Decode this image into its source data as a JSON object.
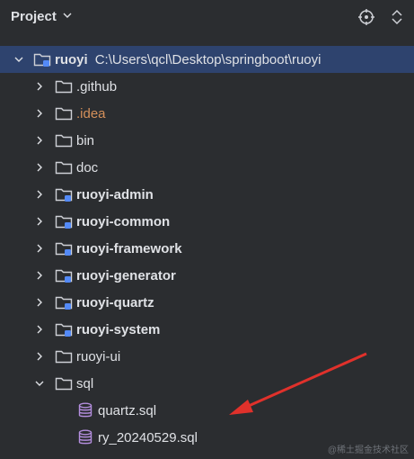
{
  "header": {
    "title": "Project",
    "icons": [
      "chevron-down-icon",
      "locate-icon",
      "expand-collapse-icon"
    ]
  },
  "tree": {
    "root": {
      "name": "ruoyi",
      "path": "C:\\Users\\qcl\\Desktop\\springboot\\ruoyi",
      "expanded": true
    },
    "items": [
      {
        "label": ".github",
        "type": "folder"
      },
      {
        "label": ".idea",
        "type": "folder"
      },
      {
        "label": "bin",
        "type": "folder"
      },
      {
        "label": "doc",
        "type": "folder"
      },
      {
        "label": "ruoyi-admin",
        "type": "module"
      },
      {
        "label": "ruoyi-common",
        "type": "module"
      },
      {
        "label": "ruoyi-framework",
        "type": "module"
      },
      {
        "label": "ruoyi-generator",
        "type": "module"
      },
      {
        "label": "ruoyi-quartz",
        "type": "module"
      },
      {
        "label": "ruoyi-system",
        "type": "module"
      },
      {
        "label": "ruoyi-ui",
        "type": "folder"
      },
      {
        "label": "sql",
        "type": "folder",
        "expanded": true
      },
      {
        "label": "quartz.sql",
        "type": "sql-file"
      },
      {
        "label": "ry_20240529.sql",
        "type": "sql-file"
      }
    ]
  },
  "watermark": "@稀土掘金技术社区",
  "colors": {
    "background": "#2b2d30",
    "selected": "#2e436e",
    "idea_text": "#d5905a",
    "module_badge": "#548af7",
    "arrow": "#e0312b"
  }
}
